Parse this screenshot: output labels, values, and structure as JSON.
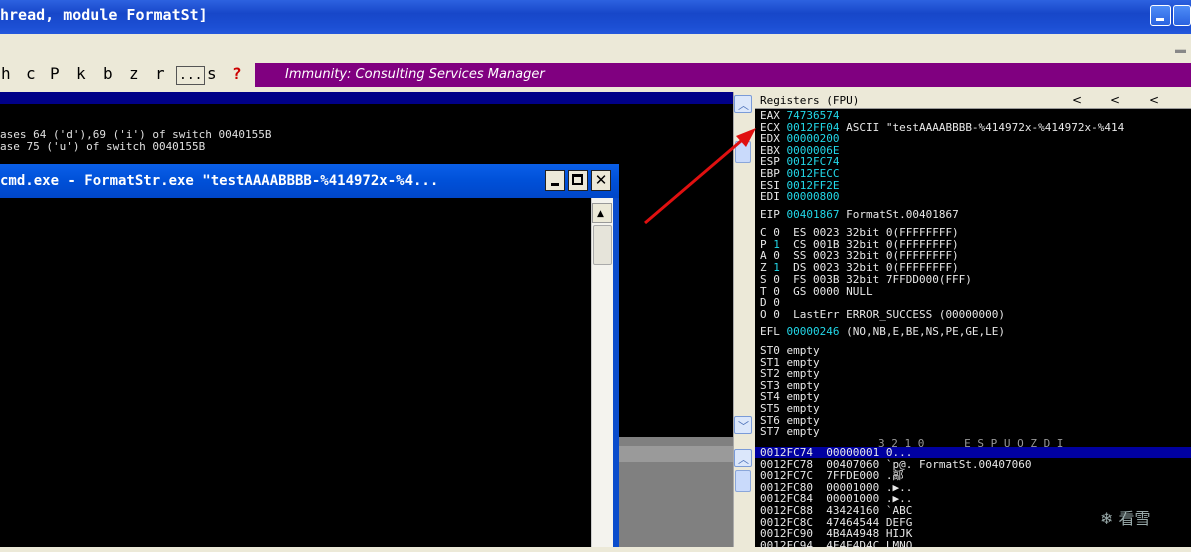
{
  "window": {
    "title": "hread, module FormatSt]"
  },
  "toolbar": {
    "letters": [
      "h",
      "c",
      "P",
      "k",
      "b",
      "z",
      "r"
    ],
    "dots_label": "...",
    "s_label": "s",
    "help_label": "?",
    "banner": "Immunity: Consulting Services Manager"
  },
  "disasm": {
    "lines": [
      "ases 64 ('d'),69 ('i') of switch 0040155B",
      "ase 75 ('u') of switch 0040155B"
    ]
  },
  "cmd": {
    "title": "cmd.exe - FormatStr.exe \"testAAAABBBB-%414972x-%4..."
  },
  "registers": {
    "header": "Registers (FPU)",
    "header_arrows": [
      "<",
      "<",
      "<"
    ],
    "gp": [
      {
        "name": "EAX",
        "value": "74736574",
        "comment": ""
      },
      {
        "name": "ECX",
        "value": "0012FF04",
        "comment": "ASCII \"testAAAABBBB-%414972x-%414972x-%414"
      },
      {
        "name": "EDX",
        "value": "00000200",
        "comment": ""
      },
      {
        "name": "EBX",
        "value": "0000006E",
        "comment": ""
      },
      {
        "name": "ESP",
        "value": "0012FC74",
        "comment": ""
      },
      {
        "name": "EBP",
        "value": "0012FECC",
        "comment": ""
      },
      {
        "name": "ESI",
        "value": "0012FF2E",
        "comment": ""
      },
      {
        "name": "EDI",
        "value": "00000800",
        "comment": ""
      }
    ],
    "eip": {
      "name": "EIP",
      "value": "00401867",
      "comment": "FormatSt.00401867"
    },
    "flags": [
      {
        "flag": "C",
        "bit": "0",
        "seg": "ES 0023 32bit 0(FFFFFFFF)"
      },
      {
        "flag": "P",
        "bit": "1",
        "seg": "CS 001B 32bit 0(FFFFFFFF)"
      },
      {
        "flag": "A",
        "bit": "0",
        "seg": "SS 0023 32bit 0(FFFFFFFF)"
      },
      {
        "flag": "Z",
        "bit": "1",
        "seg": "DS 0023 32bit 0(FFFFFFFF)"
      },
      {
        "flag": "S",
        "bit": "0",
        "seg": "FS 003B 32bit 7FFDD000(FFF)"
      },
      {
        "flag": "T",
        "bit": "0",
        "seg": "GS 0000 NULL"
      },
      {
        "flag": "D",
        "bit": "0",
        "seg": ""
      },
      {
        "flag": "O",
        "bit": "0",
        "seg": "LastErr ERROR_SUCCESS (00000000)"
      }
    ],
    "efl": {
      "name": "EFL",
      "value": "00000246",
      "comment": "(NO,NB,E,BE,NS,PE,GE,LE)"
    },
    "fpu": [
      "ST0 empty",
      "ST1 empty",
      "ST2 empty",
      "ST3 empty",
      "ST4 empty",
      "ST5 empty",
      "ST6 empty",
      "ST7 empty"
    ]
  },
  "stack": {
    "flags_header": "3 2 1 0      E S P U O Z D I",
    "rows": [
      {
        "addr": "0012FC74",
        "value": "00000001",
        "comment": "0..."
      },
      {
        "addr": "0012FC78",
        "value": "00407060",
        "comment": "`p@. FormatSt.00407060"
      },
      {
        "addr": "0012FC7C",
        "value": "7FFDE000",
        "comment": ".鄗"
      },
      {
        "addr": "0012FC80",
        "value": "00001000",
        "comment": ".▶.."
      },
      {
        "addr": "0012FC84",
        "value": "00001000",
        "comment": ".▶.."
      },
      {
        "addr": "0012FC88",
        "value": "43424160",
        "comment": "`ABC"
      },
      {
        "addr": "0012FC8C",
        "value": "47464544",
        "comment": "DEFG"
      },
      {
        "addr": "0012FC90",
        "value": "4B4A4948",
        "comment": "HIJK"
      },
      {
        "addr": "0012FC94",
        "value": "4F4E4D4C",
        "comment": "LMNO"
      }
    ]
  },
  "watermark": "看雪",
  "colors": {
    "banner": "#800080",
    "register_value": "#22d7e8",
    "arrow": "#e01010"
  }
}
